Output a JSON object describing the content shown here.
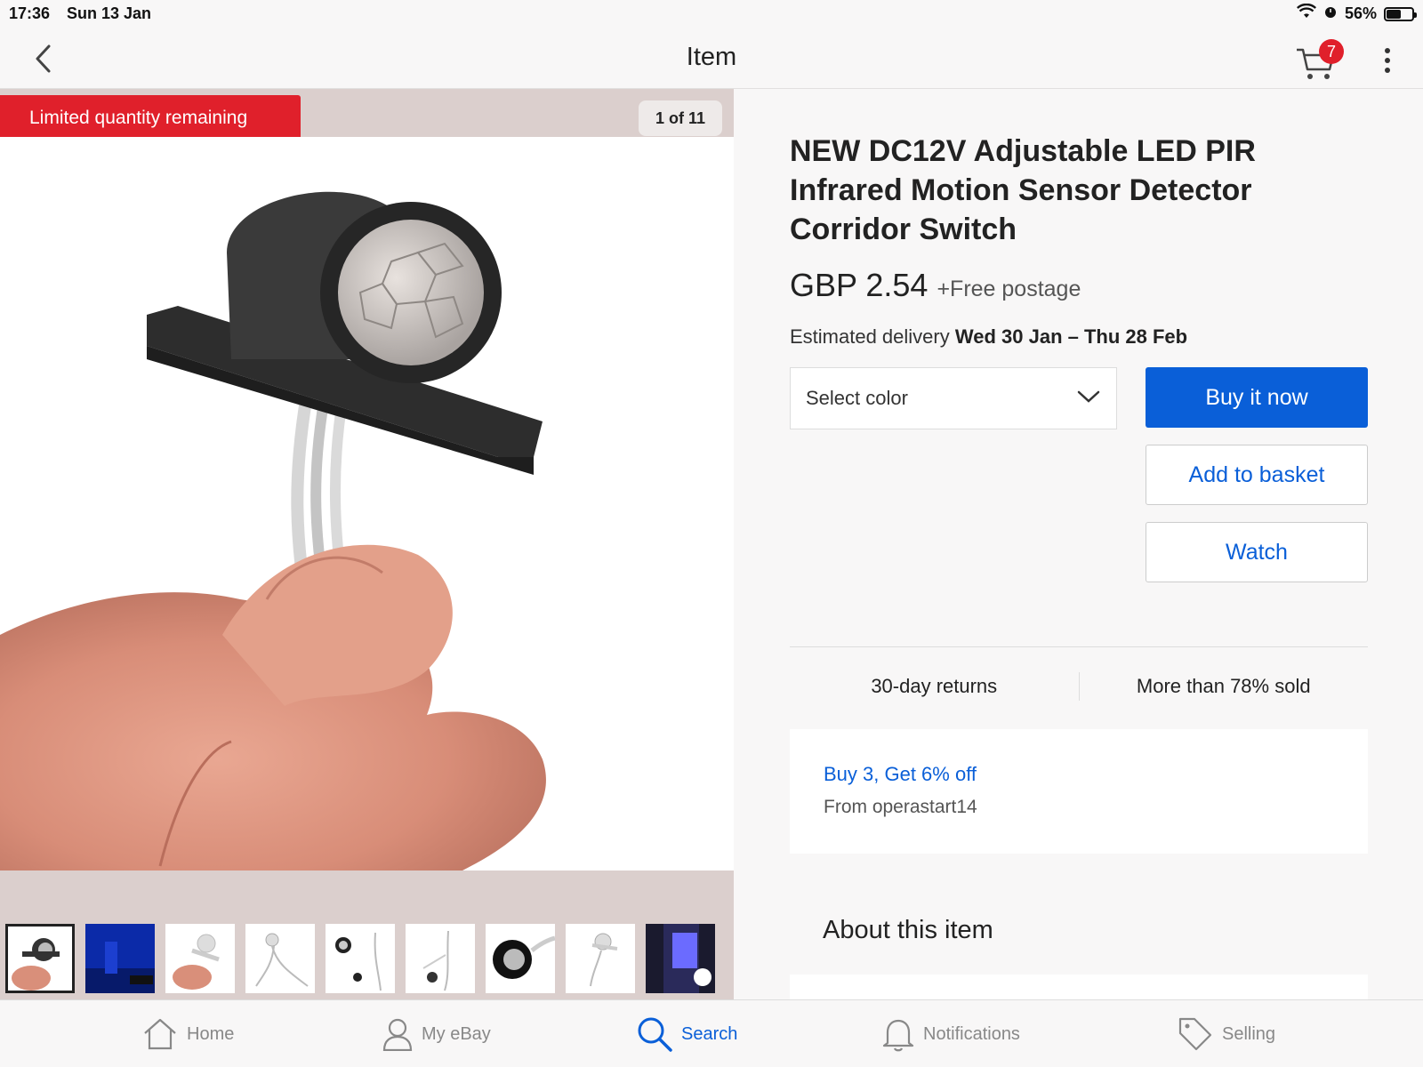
{
  "status_bar": {
    "time": "17:36",
    "date": "Sun 13 Jan",
    "battery": "56%",
    "battery_level": 0.56
  },
  "nav": {
    "title": "Item",
    "cart_count": "7",
    "icons": [
      "chevron-left-icon",
      "cart-icon",
      "more-vertical-icon"
    ]
  },
  "gallery": {
    "banner": "Limited quantity remaining",
    "counter": "1 of 11",
    "thumbnail_count": 9,
    "selected_index": 0
  },
  "product": {
    "title": "NEW DC12V Adjustable LED PIR Infrared Motion Sensor Detector Corridor Switch",
    "price": "GBP 2.54",
    "postage": "+Free postage",
    "delivery_label": "Estimated delivery",
    "delivery_dates": "Wed 30 Jan – Thu 28 Feb"
  },
  "actions": {
    "select_color": "Select color",
    "buy_now": "Buy it now",
    "add_to_basket": "Add to basket",
    "watch": "Watch"
  },
  "info": {
    "returns": "30-day returns",
    "sold": "More than 78% sold"
  },
  "promo": {
    "title": "Buy 3, Get 6% off",
    "seller": "From operastart14"
  },
  "about": {
    "heading": "About this item"
  },
  "tab_bar": {
    "items": [
      {
        "label": "Home",
        "icon": "home-icon"
      },
      {
        "label": "My eBay",
        "icon": "user-icon"
      },
      {
        "label": "Search",
        "icon": "search-icon"
      },
      {
        "label": "Notifications",
        "icon": "bell-icon"
      },
      {
        "label": "Selling",
        "icon": "tag-icon"
      }
    ],
    "active": "Search"
  },
  "colors": {
    "accent": "#0a5fd8",
    "alert": "#e0202b",
    "gallery_bg": "#dbcfcd"
  }
}
